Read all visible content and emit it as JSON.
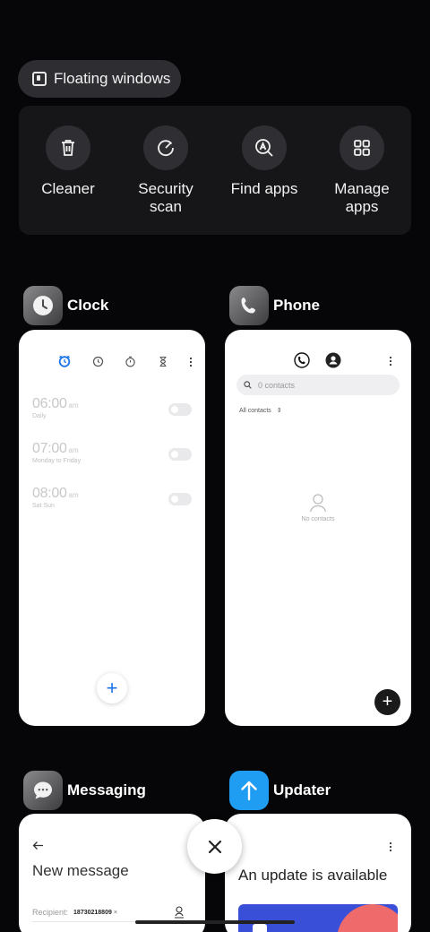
{
  "floating": {
    "label": "Floating windows"
  },
  "quick_actions": [
    {
      "label": "Cleaner",
      "icon": "trash-icon"
    },
    {
      "label": "Security scan",
      "icon": "security-scan-icon"
    },
    {
      "label": "Find apps",
      "icon": "find-apps-icon"
    },
    {
      "label": "Manage apps",
      "icon": "grid-icon"
    }
  ],
  "apps": {
    "clock": {
      "name": "Clock",
      "alarms": [
        {
          "time": "06:00",
          "ampm": "am",
          "days": "Daily"
        },
        {
          "time": "07:00",
          "ampm": "am",
          "days": "Monday to Friday"
        },
        {
          "time": "08:00",
          "ampm": "am",
          "days": "Sat Sun"
        }
      ]
    },
    "phone": {
      "name": "Phone",
      "search_placeholder": "0 contacts",
      "filter": "All contacts",
      "empty": "No contacts"
    },
    "messaging": {
      "name": "Messaging",
      "title": "New message",
      "recipient_label": "Recipient:",
      "recipient_chip": "18730218809"
    },
    "updater": {
      "name": "Updater",
      "title": "An update is available"
    }
  },
  "colors": {
    "background": "#060507",
    "panel": "#161518",
    "accent": "#1a73e8",
    "updater_icon": "#1e9df2"
  }
}
